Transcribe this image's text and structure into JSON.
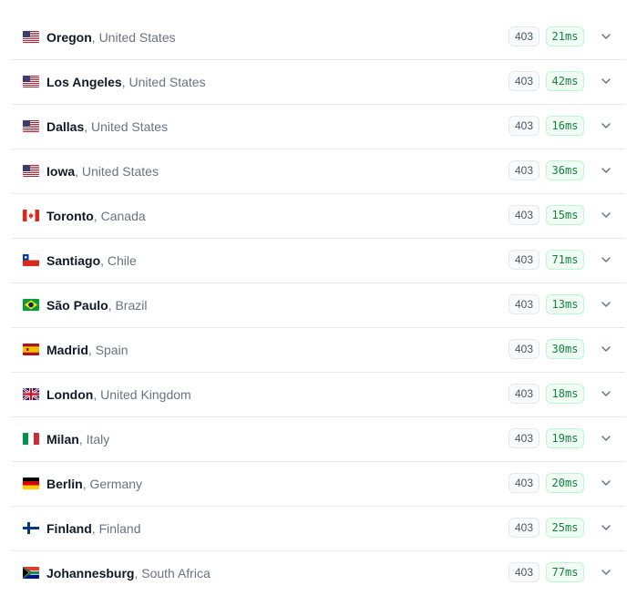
{
  "regions": [
    {
      "flag": "us-flag-icon",
      "city": "Oregon",
      "country": "United States",
      "status": "403",
      "latency": "21ms"
    },
    {
      "flag": "us-flag-icon",
      "city": "Los Angeles",
      "country": "United States",
      "status": "403",
      "latency": "42ms"
    },
    {
      "flag": "us-flag-icon",
      "city": "Dallas",
      "country": "United States",
      "status": "403",
      "latency": "16ms"
    },
    {
      "flag": "us-flag-icon",
      "city": "Iowa",
      "country": "United States",
      "status": "403",
      "latency": "36ms"
    },
    {
      "flag": "ca-flag-icon",
      "city": "Toronto",
      "country": "Canada",
      "status": "403",
      "latency": "15ms"
    },
    {
      "flag": "cl-flag-icon",
      "city": "Santiago",
      "country": "Chile",
      "status": "403",
      "latency": "71ms"
    },
    {
      "flag": "br-flag-icon",
      "city": "São Paulo",
      "country": "Brazil",
      "status": "403",
      "latency": "13ms"
    },
    {
      "flag": "es-flag-icon",
      "city": "Madrid",
      "country": "Spain",
      "status": "403",
      "latency": "30ms"
    },
    {
      "flag": "gb-flag-icon",
      "city": "London",
      "country": "United Kingdom",
      "status": "403",
      "latency": "18ms"
    },
    {
      "flag": "it-flag-icon",
      "city": "Milan",
      "country": "Italy",
      "status": "403",
      "latency": "19ms"
    },
    {
      "flag": "de-flag-icon",
      "city": "Berlin",
      "country": "Germany",
      "status": "403",
      "latency": "20ms"
    },
    {
      "flag": "fi-flag-icon",
      "city": "Finland",
      "country": "Finland",
      "status": "403",
      "latency": "25ms"
    },
    {
      "flag": "za-flag-icon",
      "city": "Johannesburg",
      "country": "South Africa",
      "status": "403",
      "latency": "77ms"
    }
  ],
  "separator": ", ",
  "colors": {
    "latency_text": "#15803d",
    "latency_bg": "#f0fdf4",
    "latency_border": "#bbf7d0",
    "status_text": "#4b5563",
    "divider": "#e5e7eb"
  }
}
